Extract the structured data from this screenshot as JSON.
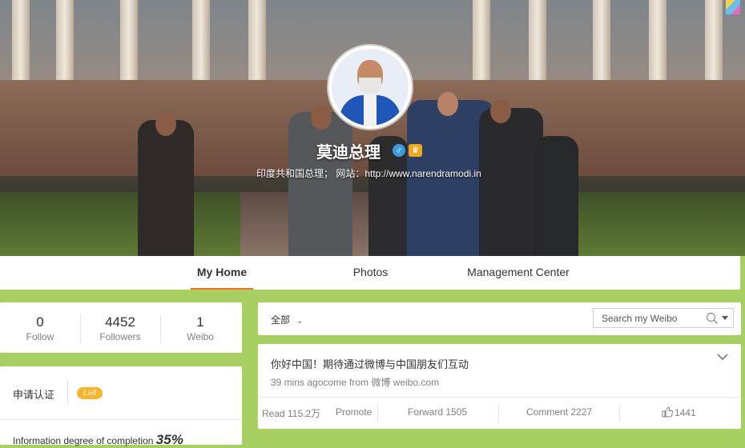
{
  "profile": {
    "name": "莫迪总理",
    "description": "印度共和国总理； 网站：http://www.narendramodi.in"
  },
  "tabs": [
    {
      "label": "My Home",
      "active": true
    },
    {
      "label": "Photos",
      "active": false
    },
    {
      "label": "Management Center",
      "active": false
    }
  ],
  "stats": [
    {
      "value": "0",
      "label": "Follow"
    },
    {
      "value": "4452",
      "label": "Followers"
    },
    {
      "value": "1",
      "label": "Weibo"
    }
  ],
  "certification": {
    "label": "申请认证",
    "level": "Lv4",
    "completion_label": "Information degree of completion",
    "completion_value": "35%"
  },
  "filter": {
    "label": "全部",
    "search_placeholder": "Search my Weibo"
  },
  "post": {
    "text": "你好中国！期待通过微博与中国朋友们互动",
    "meta": "39 mins agocome from 微博 weibo.com",
    "read": "Read 115.2万",
    "promote": "Promote",
    "forward": "Forward 1505",
    "comment": "Comment 2227",
    "likes": "1441"
  },
  "colors": {
    "page_background": "#a8cf62",
    "active_tab_underline": "#f86b1e",
    "level_badge": "#f7b52c"
  }
}
